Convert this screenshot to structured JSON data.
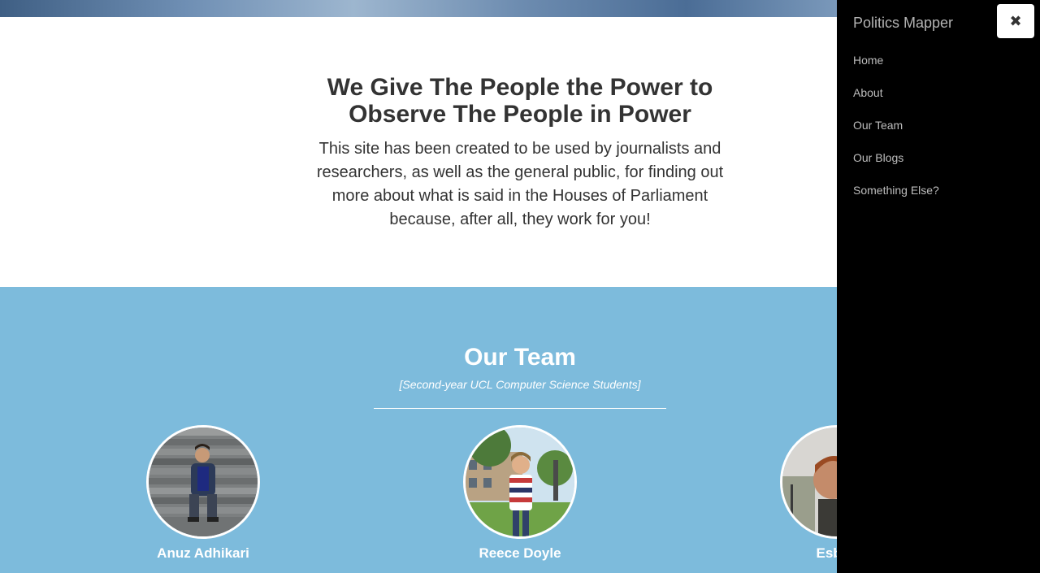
{
  "intro": {
    "title_line1": "We Give The People the Power to",
    "title_line2": "Observe The People in Power",
    "text": "This site has been created to be used by journalists and researchers, as well as the general public, for finding out more about what is said in the Houses of Parliament because, after all, they work for you!"
  },
  "team": {
    "title": "Our Team",
    "subtitle": "[Second-year UCL Computer Science Students]",
    "members": [
      {
        "name": "Anuz Adhikari"
      },
      {
        "name": "Reece Doyle"
      },
      {
        "name": "Esben"
      }
    ]
  },
  "drawer": {
    "brand": "Politics Mapper",
    "close_icon": "close-icon",
    "close_glyph": "✖",
    "nav": [
      {
        "label": "Home"
      },
      {
        "label": "About"
      },
      {
        "label": "Our Team"
      },
      {
        "label": "Our Blogs"
      },
      {
        "label": "Something Else?"
      }
    ]
  },
  "colors": {
    "team_background": "#7dbbdc",
    "drawer_background": "#000000",
    "text_dark": "#333333"
  }
}
